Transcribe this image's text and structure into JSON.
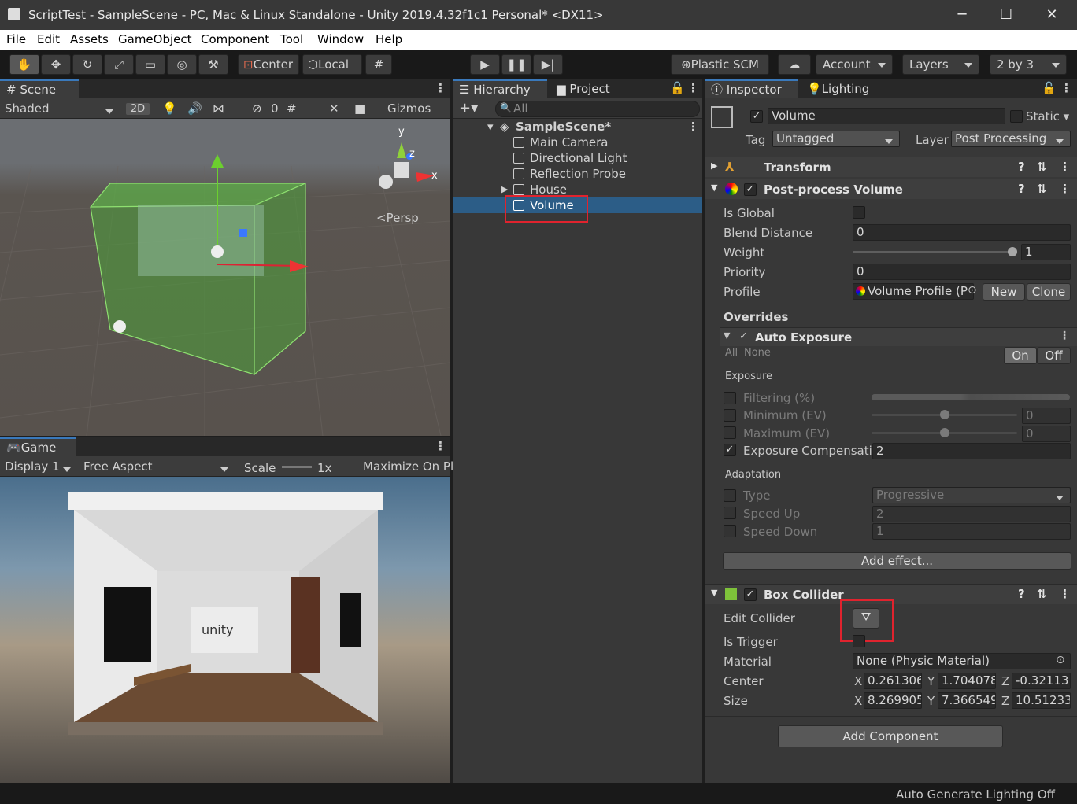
{
  "window": {
    "title": "ScriptTest - SampleScene - PC, Mac & Linux Standalone - Unity 2019.4.32f1c1 Personal* <DX11>",
    "minimize": "─",
    "maximize": "☐",
    "close": "✕"
  },
  "menu": [
    "File",
    "Edit",
    "Assets",
    "GameObject",
    "Component",
    "Tool",
    "Window",
    "Help"
  ],
  "toolbar": {
    "center": "Center",
    "local": "Local",
    "plastic": "Plastic SCM",
    "account": "Account",
    "layers": "Layers",
    "layout": "2 by 3"
  },
  "scene": {
    "tab": "Scene",
    "shading": "Shaded",
    "mode2d": "2D",
    "gizmos": "Gizmos",
    "hidden_count": "0",
    "persp": "Persp",
    "axis_x": "x",
    "axis_y": "y",
    "axis_z": "z"
  },
  "game": {
    "tab": "Game",
    "display": "Display 1",
    "aspect": "Free Aspect",
    "scale_label": "Scale",
    "scale_value": "1x",
    "maximize": "Maximize On Pl",
    "logo_text": "unity"
  },
  "hierarchy": {
    "tab": "Hierarchy",
    "project_tab": "Project",
    "search_placeholder": "All",
    "scene": "SampleScene*",
    "items": [
      "Main Camera",
      "Directional Light",
      "Reflection Probe",
      "House",
      "Volume"
    ],
    "selected": "Volume"
  },
  "inspector": {
    "tab": "Inspector",
    "lighting_tab": "Lighting",
    "object_name": "Volume",
    "static": "Static",
    "tag_label": "Tag",
    "tag": "Untagged",
    "layer_label": "Layer",
    "layer": "Post Processing",
    "transform": "Transform",
    "ppv": {
      "title": "Post-process Volume",
      "is_global": "Is Global",
      "blend_distance": "Blend Distance",
      "blend_value": "0",
      "weight": "Weight",
      "weight_value": "1",
      "weight_fraction": 1.0,
      "priority": "Priority",
      "priority_value": "0",
      "profile": "Profile",
      "profile_value": "Volume Profile (P",
      "new": "New",
      "clone": "Clone",
      "overrides": "Overrides"
    },
    "auto_exposure": {
      "title": "Auto Exposure",
      "all": "All",
      "none": "None",
      "on": "On",
      "off": "Off",
      "exposure_section": "Exposure",
      "filtering": "Filtering (%)",
      "minimum": "Minimum (EV)",
      "minimum_value": "0",
      "maximum": "Maximum (EV)",
      "maximum_value": "0",
      "compensation": "Exposure Compensatic",
      "compensation_value": "2",
      "adaptation_section": "Adaptation",
      "type": "Type",
      "type_value": "Progressive",
      "speed_up": "Speed Up",
      "speed_up_value": "2",
      "speed_down": "Speed Down",
      "speed_down_value": "1",
      "add_effect": "Add effect..."
    },
    "box_collider": {
      "title": "Box Collider",
      "edit_collider": "Edit Collider",
      "is_trigger": "Is Trigger",
      "material": "Material",
      "material_value": "None (Physic Material)",
      "center": "Center",
      "center_x": "0.261306",
      "center_y": "1.704078",
      "center_z": "-0.32113",
      "size": "Size",
      "size_x": "8.269905",
      "size_y": "7.366549",
      "size_z": "10.51233",
      "x": "X",
      "y": "Y",
      "z": "Z"
    },
    "add_component": "Add Component"
  },
  "status": {
    "lighting": "Auto Generate Lighting Off"
  },
  "colors": {
    "accent": "#3a79bb",
    "selection": "#2c5d87",
    "highlight": "#e0232e",
    "volume_green": "#5fbf4a"
  }
}
